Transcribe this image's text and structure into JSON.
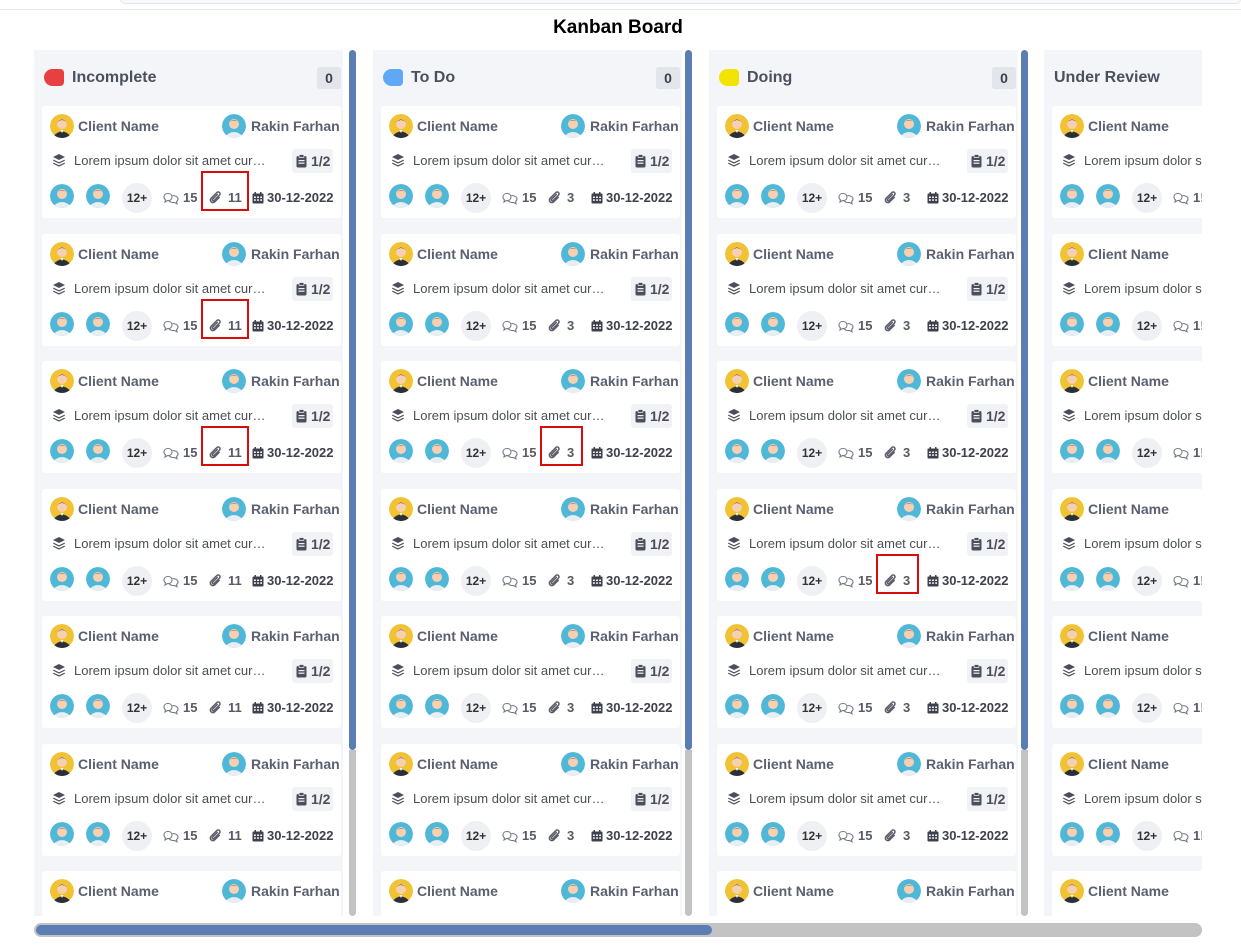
{
  "board": {
    "title": "Kanban Board"
  },
  "columns": [
    {
      "title": "Incomplete",
      "count": "0",
      "color": "#e84040",
      "cards_attachments": "11",
      "highlight_cards": [
        0,
        1,
        2
      ]
    },
    {
      "title": "To Do",
      "count": "0",
      "color": "#5fa8f5",
      "cards_attachments": "3",
      "highlight_cards": [
        2
      ]
    },
    {
      "title": "Doing",
      "count": "0",
      "color": "#f3e300",
      "cards_attachments": "3",
      "highlight_cards": [
        3
      ]
    },
    {
      "title": "Under Review",
      "count": "",
      "color": "",
      "cards_attachments": "",
      "highlight_cards": []
    }
  ],
  "card_template": {
    "client_label": "Client Name",
    "assignee_name": "Rakin Farhan",
    "description": "Lorem ipsum dolor sit amet curn...",
    "description_cut": "Lorem ipsum dolor s",
    "task_progress": "1/2",
    "more_members": "12+",
    "comments": "15",
    "comments_cut": "1!",
    "due_date": "30-12-2022"
  },
  "icons": {
    "stack": "layers-icon",
    "task": "clipboard-icon",
    "comment": "comment-icon",
    "attachment": "paperclip-icon",
    "date": "calendar-icon"
  },
  "colors": {
    "scroll_thumb": "#5b7db4",
    "scroll_track": "#c3c3c3",
    "highlight": "#d80d0d",
    "column_bg": "#f3f5f9"
  }
}
